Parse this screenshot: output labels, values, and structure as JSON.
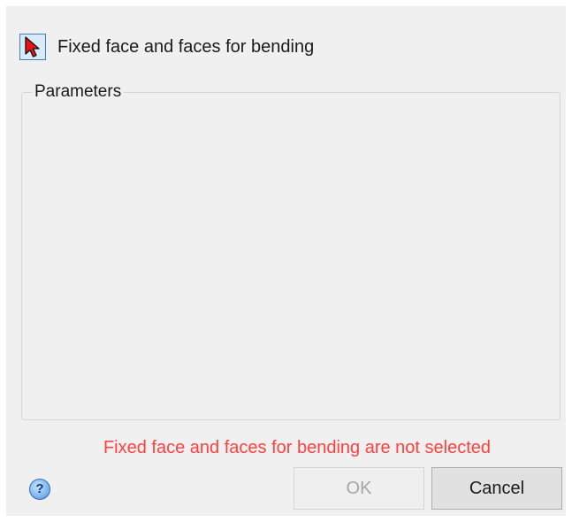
{
  "dialog": {
    "selector": {
      "icon": "red-arrow-cursor-icon",
      "label": "Fixed face and faces for bending"
    },
    "parameters_group": {
      "title": "Parameters"
    },
    "status_message": "Fixed face and faces for bending are not selected",
    "help_icon_glyph": "?",
    "buttons": {
      "ok_label": "OK",
      "ok_enabled": false,
      "cancel_label": "Cancel"
    }
  },
  "colors": {
    "dialog_background": "#f0f0f0",
    "error_text": "#ff4040",
    "selector_button_border": "#3c7fb1",
    "selector_button_fill": "#d9ebf9",
    "cursor_icon_red": "#e8141a"
  }
}
